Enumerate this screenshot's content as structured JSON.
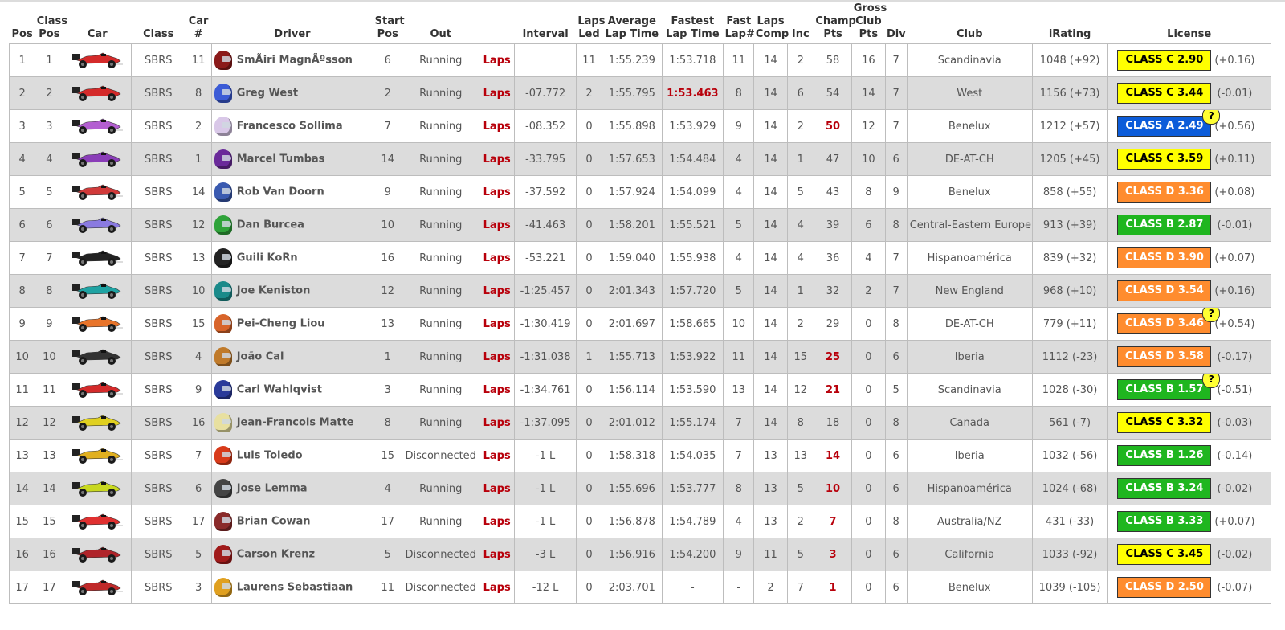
{
  "headers": {
    "pos": "Pos",
    "class_pos": "Class\nPos",
    "car": "Car",
    "class": "Class",
    "car_num": "Car\n#",
    "driver": "Driver",
    "start_pos": "Start\nPos",
    "out": "Out",
    "interval": "Interval",
    "laps_led": "Laps\nLed",
    "avg_lap": "Average\nLap Time",
    "fast_lap": "Fastest\nLap Time",
    "fast_lap_num": "Fast\nLap#",
    "laps_comp": "Laps\nComp",
    "inc": "Inc",
    "champ_pts": "Champ\nPts",
    "gross_club_pts": "Gross\nClub\nPts",
    "div": "Div",
    "club": "Club",
    "irating": "iRating",
    "license": "License"
  },
  "laps_label": "Laps",
  "colors": {
    "class_c": "#ffff00",
    "class_a": "#0c5cd9",
    "class_d": "#ff8c2e",
    "class_b": "#1fb61f",
    "accent_red": "#b8000b",
    "alt_row": "#dcdcdc"
  },
  "rows": [
    {
      "pos": "1",
      "class_pos": "1",
      "car_color": "#d42a2a",
      "class": "SBRS",
      "car_num": "11",
      "helmet": "#8b1a1a",
      "driver": "SmÃiri MagnÃºsson",
      "start": "6",
      "out": "Running",
      "interval": "",
      "laps_led": "11",
      "avg": "1:55.239",
      "fast": "1:53.718",
      "fast_red": false,
      "fast_lap": "11",
      "laps_comp": "14",
      "inc": "2",
      "champ": "58",
      "champ_red": false,
      "club_pts": "16",
      "div": "7",
      "club": "Scandinavia",
      "irating": "1048 (+92)",
      "lic": "CLASS C 2.90",
      "lic_class": "class_c",
      "q": false,
      "chg": "(+0.16)"
    },
    {
      "pos": "2",
      "class_pos": "2",
      "car_color": "#d42a2a",
      "class": "SBRS",
      "car_num": "8",
      "helmet": "#3b5bd6",
      "driver": "Greg West",
      "start": "2",
      "out": "Running",
      "interval": "-07.772",
      "laps_led": "2",
      "avg": "1:55.795",
      "fast": "1:53.463",
      "fast_red": true,
      "fast_lap": "8",
      "laps_comp": "14",
      "inc": "6",
      "champ": "54",
      "champ_red": false,
      "club_pts": "14",
      "div": "7",
      "club": "West",
      "irating": "1156 (+73)",
      "lic": "CLASS C 3.44",
      "lic_class": "class_c",
      "q": false,
      "chg": "(-0.01)"
    },
    {
      "pos": "3",
      "class_pos": "3",
      "car_color": "#b35fd1",
      "class": "SBRS",
      "car_num": "2",
      "helmet": "#d9c8e8",
      "driver": "Francesco Sollima",
      "start": "7",
      "out": "Running",
      "interval": "-08.352",
      "laps_led": "0",
      "avg": "1:55.898",
      "fast": "1:53.929",
      "fast_red": false,
      "fast_lap": "9",
      "laps_comp": "14",
      "inc": "2",
      "champ": "50",
      "champ_red": true,
      "club_pts": "12",
      "div": "7",
      "club": "Benelux",
      "irating": "1212 (+57)",
      "lic": "CLASS A 2.49",
      "lic_class": "class_a",
      "q": true,
      "chg": "(+0.56)"
    },
    {
      "pos": "4",
      "class_pos": "4",
      "car_color": "#8a3db8",
      "class": "SBRS",
      "car_num": "1",
      "helmet": "#6a2a9a",
      "driver": "Marcel Tumbas",
      "start": "14",
      "out": "Running",
      "interval": "-33.795",
      "laps_led": "0",
      "avg": "1:57.653",
      "fast": "1:54.484",
      "fast_red": false,
      "fast_lap": "4",
      "laps_comp": "14",
      "inc": "1",
      "champ": "47",
      "champ_red": false,
      "club_pts": "10",
      "div": "6",
      "club": "DE-AT-CH",
      "irating": "1205 (+45)",
      "lic": "CLASS C 3.59",
      "lic_class": "class_c",
      "q": false,
      "chg": "(+0.11)"
    },
    {
      "pos": "5",
      "class_pos": "5",
      "car_color": "#d13a3a",
      "class": "SBRS",
      "car_num": "14",
      "helmet": "#3a5ab0",
      "driver": "Rob Van Doorn",
      "start": "9",
      "out": "Running",
      "interval": "-37.592",
      "laps_led": "0",
      "avg": "1:57.924",
      "fast": "1:54.099",
      "fast_red": false,
      "fast_lap": "4",
      "laps_comp": "14",
      "inc": "5",
      "champ": "43",
      "champ_red": false,
      "club_pts": "8",
      "div": "9",
      "club": "Benelux",
      "irating": "858 (+55)",
      "lic": "CLASS D 3.36",
      "lic_class": "class_d",
      "q": false,
      "chg": "(+0.08)"
    },
    {
      "pos": "6",
      "class_pos": "6",
      "car_color": "#8a7ae0",
      "class": "SBRS",
      "car_num": "12",
      "helmet": "#2fa33a",
      "driver": "Dan Burcea",
      "start": "10",
      "out": "Running",
      "interval": "-41.463",
      "laps_led": "0",
      "avg": "1:58.201",
      "fast": "1:55.521",
      "fast_red": false,
      "fast_lap": "5",
      "laps_comp": "14",
      "inc": "4",
      "champ": "39",
      "champ_red": false,
      "club_pts": "6",
      "div": "8",
      "club": "Central-Eastern Europe",
      "irating": "913 (+39)",
      "lic": "CLASS B 2.87",
      "lic_class": "class_b",
      "q": false,
      "chg": "(-0.01)"
    },
    {
      "pos": "7",
      "class_pos": "7",
      "car_color": "#222222",
      "class": "SBRS",
      "car_num": "13",
      "helmet": "#222222",
      "driver": "Guili KoRn",
      "start": "16",
      "out": "Running",
      "interval": "-53.221",
      "laps_led": "0",
      "avg": "1:59.040",
      "fast": "1:55.938",
      "fast_red": false,
      "fast_lap": "4",
      "laps_comp": "14",
      "inc": "4",
      "champ": "36",
      "champ_red": false,
      "club_pts": "4",
      "div": "7",
      "club": "Hispanoamérica",
      "irating": "839 (+32)",
      "lic": "CLASS D 3.90",
      "lic_class": "class_d",
      "q": false,
      "chg": "(+0.07)"
    },
    {
      "pos": "8",
      "class_pos": "8",
      "car_color": "#1fa3a3",
      "class": "SBRS",
      "car_num": "10",
      "helmet": "#1a8a8a",
      "driver": "Joe Keniston",
      "start": "12",
      "out": "Running",
      "interval": "-1:25.457",
      "laps_led": "0",
      "avg": "2:01.343",
      "fast": "1:57.720",
      "fast_red": false,
      "fast_lap": "5",
      "laps_comp": "14",
      "inc": "1",
      "champ": "32",
      "champ_red": false,
      "club_pts": "2",
      "div": "7",
      "club": "New England",
      "irating": "968 (+10)",
      "lic": "CLASS D 3.54",
      "lic_class": "class_d",
      "q": false,
      "chg": "(+0.16)"
    },
    {
      "pos": "9",
      "class_pos": "9",
      "car_color": "#e8742a",
      "class": "SBRS",
      "car_num": "15",
      "helmet": "#d8642a",
      "driver": "Pei-Cheng Liou",
      "start": "13",
      "out": "Running",
      "interval": "-1:30.419",
      "laps_led": "0",
      "avg": "2:01.697",
      "fast": "1:58.665",
      "fast_red": false,
      "fast_lap": "10",
      "laps_comp": "14",
      "inc": "2",
      "champ": "29",
      "champ_red": false,
      "club_pts": "0",
      "div": "8",
      "club": "DE-AT-CH",
      "irating": "779 (+11)",
      "lic": "CLASS D 3.46",
      "lic_class": "class_d",
      "q": true,
      "chg": "(+0.54)"
    },
    {
      "pos": "10",
      "class_pos": "10",
      "car_color": "#333333",
      "class": "SBRS",
      "car_num": "4",
      "helmet": "#c07a2a",
      "driver": "João Cal",
      "start": "1",
      "out": "Running",
      "interval": "-1:31.038",
      "laps_led": "1",
      "avg": "1:55.713",
      "fast": "1:53.922",
      "fast_red": false,
      "fast_lap": "11",
      "laps_comp": "14",
      "inc": "15",
      "champ": "25",
      "champ_red": true,
      "club_pts": "0",
      "div": "6",
      "club": "Iberia",
      "irating": "1112 (-23)",
      "lic": "CLASS D 3.58",
      "lic_class": "class_d",
      "q": false,
      "chg": "(-0.17)"
    },
    {
      "pos": "11",
      "class_pos": "11",
      "car_color": "#d42a2a",
      "class": "SBRS",
      "car_num": "9",
      "helmet": "#2a3a9a",
      "driver": "Carl Wahlqvist",
      "start": "3",
      "out": "Running",
      "interval": "-1:34.761",
      "laps_led": "0",
      "avg": "1:56.114",
      "fast": "1:53.590",
      "fast_red": false,
      "fast_lap": "13",
      "laps_comp": "14",
      "inc": "12",
      "champ": "21",
      "champ_red": true,
      "club_pts": "0",
      "div": "5",
      "club": "Scandinavia",
      "irating": "1028 (-30)",
      "lic": "CLASS B 1.57",
      "lic_class": "class_b",
      "q": true,
      "chg": "(-0.51)"
    },
    {
      "pos": "12",
      "class_pos": "12",
      "car_color": "#e0d020",
      "class": "SBRS",
      "car_num": "16",
      "helmet": "#e8e0a0",
      "driver": "Jean-Francois Matte",
      "start": "8",
      "out": "Running",
      "interval": "-1:37.095",
      "laps_led": "0",
      "avg": "2:01.012",
      "fast": "1:55.174",
      "fast_red": false,
      "fast_lap": "7",
      "laps_comp": "14",
      "inc": "8",
      "champ": "18",
      "champ_red": false,
      "club_pts": "0",
      "div": "8",
      "club": "Canada",
      "irating": "561 (-7)",
      "lic": "CLASS C 3.32",
      "lic_class": "class_c",
      "q": false,
      "chg": "(-0.03)"
    },
    {
      "pos": "13",
      "class_pos": "13",
      "car_color": "#e0b020",
      "class": "SBRS",
      "car_num": "7",
      "helmet": "#d83a1a",
      "driver": "Luis Toledo",
      "start": "15",
      "out": "Disconnected",
      "interval": "-1 L",
      "laps_led": "0",
      "avg": "1:58.318",
      "fast": "1:54.035",
      "fast_red": false,
      "fast_lap": "7",
      "laps_comp": "13",
      "inc": "13",
      "champ": "14",
      "champ_red": true,
      "club_pts": "0",
      "div": "6",
      "club": "Iberia",
      "irating": "1032 (-56)",
      "lic": "CLASS B 1.26",
      "lic_class": "class_b",
      "q": false,
      "chg": "(-0.14)"
    },
    {
      "pos": "14",
      "class_pos": "14",
      "car_color": "#c8d820",
      "class": "SBRS",
      "car_num": "6",
      "helmet": "#444444",
      "driver": "Jose Lemma",
      "start": "4",
      "out": "Running",
      "interval": "-1 L",
      "laps_led": "0",
      "avg": "1:55.696",
      "fast": "1:53.777",
      "fast_red": false,
      "fast_lap": "8",
      "laps_comp": "13",
      "inc": "5",
      "champ": "10",
      "champ_red": true,
      "club_pts": "0",
      "div": "6",
      "club": "Hispanoamérica",
      "irating": "1024 (-68)",
      "lic": "CLASS B 3.24",
      "lic_class": "class_b",
      "q": false,
      "chg": "(-0.02)"
    },
    {
      "pos": "15",
      "class_pos": "15",
      "car_color": "#e03030",
      "class": "SBRS",
      "car_num": "17",
      "helmet": "#8a2a2a",
      "driver": "Brian Cowan",
      "start": "17",
      "out": "Running",
      "interval": "-1 L",
      "laps_led": "0",
      "avg": "1:56.878",
      "fast": "1:54.789",
      "fast_red": false,
      "fast_lap": "4",
      "laps_comp": "13",
      "inc": "2",
      "champ": "7",
      "champ_red": true,
      "club_pts": "0",
      "div": "8",
      "club": "Australia/NZ",
      "irating": "431 (-33)",
      "lic": "CLASS B 3.33",
      "lic_class": "class_b",
      "q": false,
      "chg": "(+0.07)"
    },
    {
      "pos": "16",
      "class_pos": "16",
      "car_color": "#b0242a",
      "class": "SBRS",
      "car_num": "5",
      "helmet": "#a01a1a",
      "driver": "Carson Krenz",
      "start": "5",
      "out": "Disconnected",
      "interval": "-3 L",
      "laps_led": "0",
      "avg": "1:56.916",
      "fast": "1:54.200",
      "fast_red": false,
      "fast_lap": "9",
      "laps_comp": "11",
      "inc": "5",
      "champ": "3",
      "champ_red": true,
      "club_pts": "0",
      "div": "6",
      "club": "California",
      "irating": "1033 (-92)",
      "lic": "CLASS C 3.45",
      "lic_class": "class_c",
      "q": false,
      "chg": "(-0.02)"
    },
    {
      "pos": "17",
      "class_pos": "17",
      "car_color": "#c02a2a",
      "class": "SBRS",
      "car_num": "3",
      "helmet": "#e0a020",
      "driver": "Laurens Sebastiaan",
      "start": "11",
      "out": "Disconnected",
      "interval": "-12 L",
      "laps_led": "0",
      "avg": "2:03.701",
      "fast": "-",
      "fast_red": false,
      "fast_lap": "-",
      "laps_comp": "2",
      "inc": "7",
      "champ": "1",
      "champ_red": true,
      "club_pts": "0",
      "div": "6",
      "club": "Benelux",
      "irating": "1039 (-105)",
      "lic": "CLASS D 2.50",
      "lic_class": "class_d",
      "q": false,
      "chg": "(-0.07)"
    }
  ]
}
